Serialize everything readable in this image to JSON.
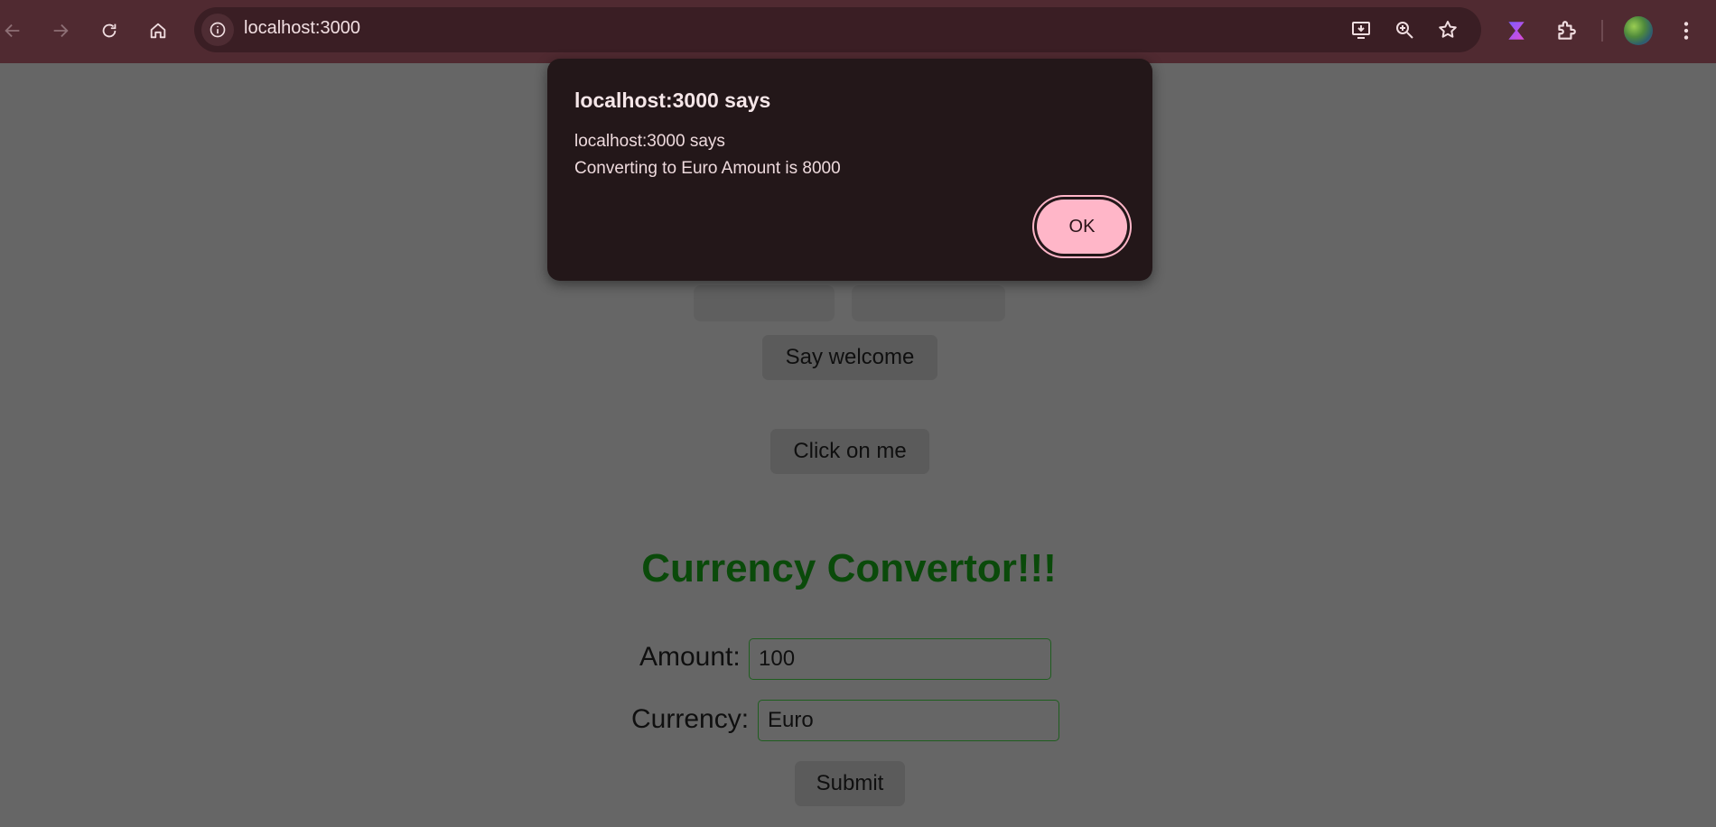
{
  "browser": {
    "url": "localhost:3000",
    "icons": {
      "back": "arrow-left-icon",
      "forward": "arrow-right-icon",
      "reload": "reload-icon",
      "home": "home-icon",
      "site_info": "info-icon",
      "install": "install-app-icon",
      "zoom": "zoom-icon",
      "bookmark": "star-icon",
      "extension_app": "hourglass-icon",
      "extensions": "puzzle-icon",
      "profile": "avatar",
      "menu": "kebab-menu-icon"
    }
  },
  "dialog": {
    "title": "localhost:3000 says",
    "message_line1": "localhost:3000 says",
    "message_line2": "Converting to Euro Amount is 8000",
    "ok_label": "OK"
  },
  "page": {
    "say_welcome_label": "Say welcome",
    "click_on_me_label": "Click on me",
    "heading": "Currency Convertor!!!",
    "amount_label": "Amount:",
    "amount_value": "100",
    "currency_label": "Currency:",
    "currency_value": "Euro",
    "submit_label": "Submit"
  },
  "colors": {
    "toolbar": "#502a31",
    "overlay_page": "#666666",
    "heading": "#0a4a0a",
    "dialog_bg": "#231719",
    "ok_button": "#ffb6c8"
  }
}
